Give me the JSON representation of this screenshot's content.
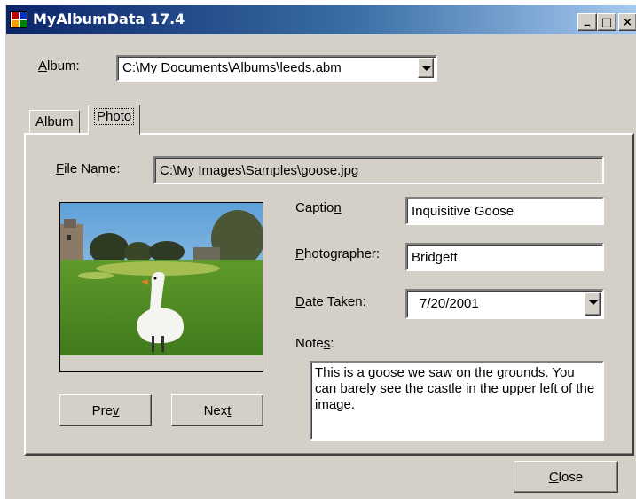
{
  "window": {
    "title": "MyAlbumData 17.4",
    "minimize_glyph": "_",
    "maximize_glyph": "□",
    "close_glyph": "×"
  },
  "album": {
    "label_accel": "A",
    "label_rest": "lbum:",
    "value": "C:\\My Documents\\Albums\\leeds.abm"
  },
  "tabs": [
    {
      "label": "Album",
      "active": false
    },
    {
      "label": "Photo",
      "active": true
    }
  ],
  "photo": {
    "file_name_accel": "F",
    "file_name_rest": "ile Name:",
    "file_name_value": "C:\\My Images\\Samples\\goose.jpg",
    "caption_label_pre": "Captio",
    "caption_label_accel": "n",
    "caption_value": "Inquisitive Goose",
    "photographer_label_accel": "P",
    "photographer_label_rest": "hotographer:",
    "photographer_value": "Bridgett",
    "date_label_accel": "D",
    "date_label_rest": "ate Taken:",
    "date_value": "7/20/2001",
    "notes_label_pre": "Note",
    "notes_label_accel": "s",
    "notes_label_post": ":",
    "notes_value": "This is a goose we saw on the grounds. You can barely see the castle in the upper left of the image.",
    "prev_pre": "Pre",
    "prev_accel": "v",
    "next_pre": "Nex",
    "next_accel": "t"
  },
  "footer": {
    "close_accel": "C",
    "close_rest": "lose"
  },
  "colors": {
    "face": "#d4d0c8",
    "title_start": "#0a246a",
    "title_end": "#a6caf0"
  }
}
